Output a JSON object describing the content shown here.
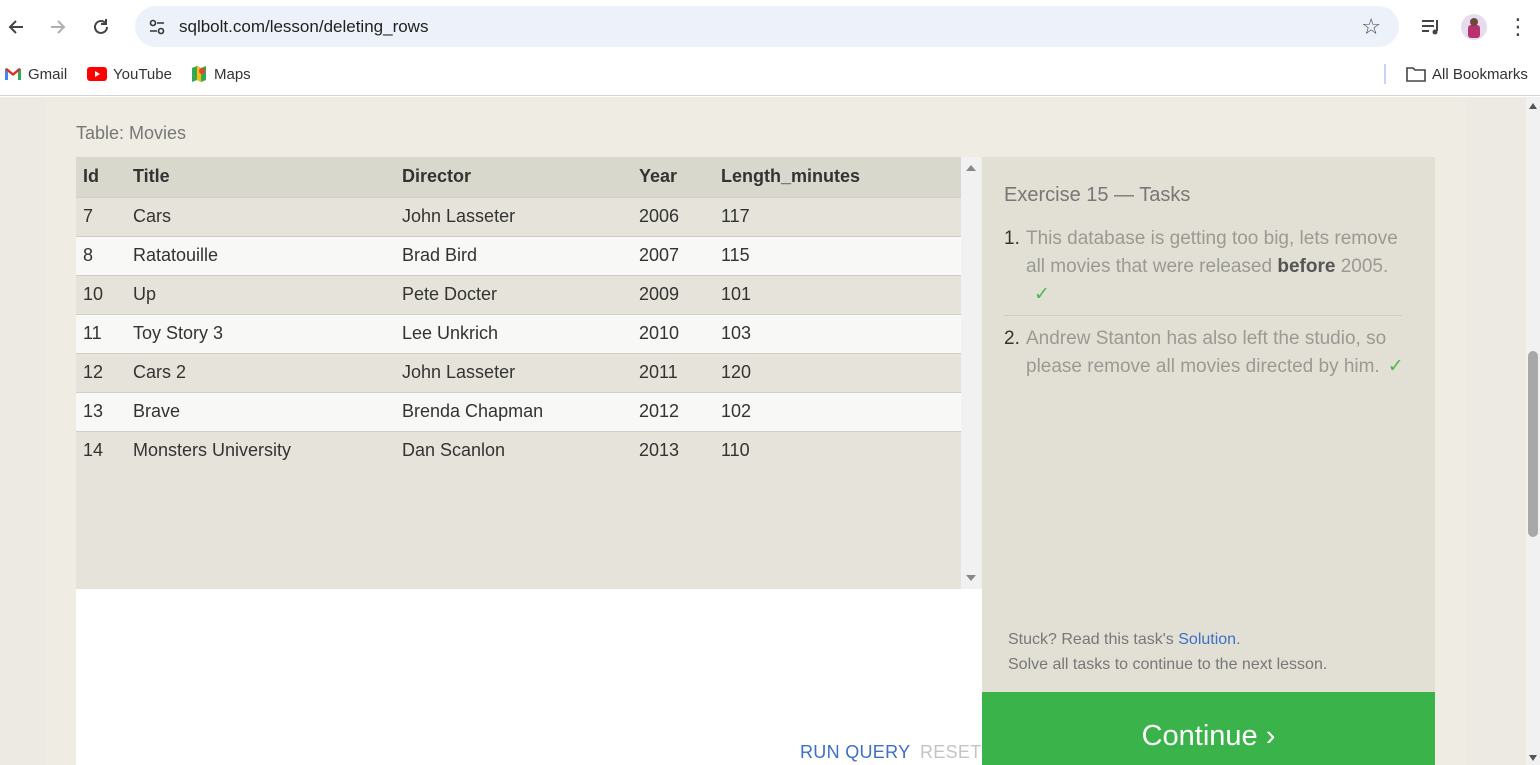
{
  "browser": {
    "url": "sqlbolt.com/lesson/deleting_rows",
    "icons": {
      "back": "arrow-left-icon",
      "forward": "arrow-right-icon",
      "reload": "reload-icon",
      "site_info": "tune-icon",
      "bookmark_star": "star-icon",
      "media": "playlist-icon",
      "profile": "avatar",
      "menu": "kebab-menu-icon"
    }
  },
  "bookmarks": {
    "items": [
      {
        "label": "Gmail",
        "icon": "gmail-icon"
      },
      {
        "label": "YouTube",
        "icon": "youtube-icon"
      },
      {
        "label": "Maps",
        "icon": "maps-icon"
      }
    ],
    "all_bookmarks": "All Bookmarks"
  },
  "lesson": {
    "table_caption": "Table: Movies",
    "columns": [
      "Id",
      "Title",
      "Director",
      "Year",
      "Length_minutes"
    ],
    "rows": [
      [
        "7",
        "Cars",
        "John Lasseter",
        "2006",
        "117"
      ],
      [
        "8",
        "Ratatouille",
        "Brad Bird",
        "2007",
        "115"
      ],
      [
        "10",
        "Up",
        "Pete Docter",
        "2009",
        "101"
      ],
      [
        "11",
        "Toy Story 3",
        "Lee Unkrich",
        "2010",
        "103"
      ],
      [
        "12",
        "Cars 2",
        "John Lasseter",
        "2011",
        "120"
      ],
      [
        "13",
        "Brave",
        "Brenda Chapman",
        "2012",
        "102"
      ],
      [
        "14",
        "Monsters University",
        "Dan Scanlon",
        "2013",
        "110"
      ]
    ],
    "run_query": "RUN QUERY",
    "reset": "RESET"
  },
  "tasks": {
    "title": "Exercise 15 — Tasks",
    "items": [
      {
        "num": "1.",
        "before": "This database is getting too big, lets remove all movies that were released ",
        "bold": "before",
        "after": " 2005.",
        "check": "✓"
      },
      {
        "num": "2.",
        "text": "Andrew Stanton has also left the studio, so please remove all movies directed by him.",
        "check": "✓"
      }
    ],
    "stuck_prefix": "Stuck? Read this task's ",
    "solution_link": "Solution",
    "stuck_suffix": ".",
    "continue_note": "Solve all tasks to continue to the next lesson.",
    "continue_button": "Continue ›"
  },
  "colors": {
    "accent_green": "#3ab44a",
    "link_blue": "#3d6fc8",
    "check_green": "#4bb84b"
  }
}
